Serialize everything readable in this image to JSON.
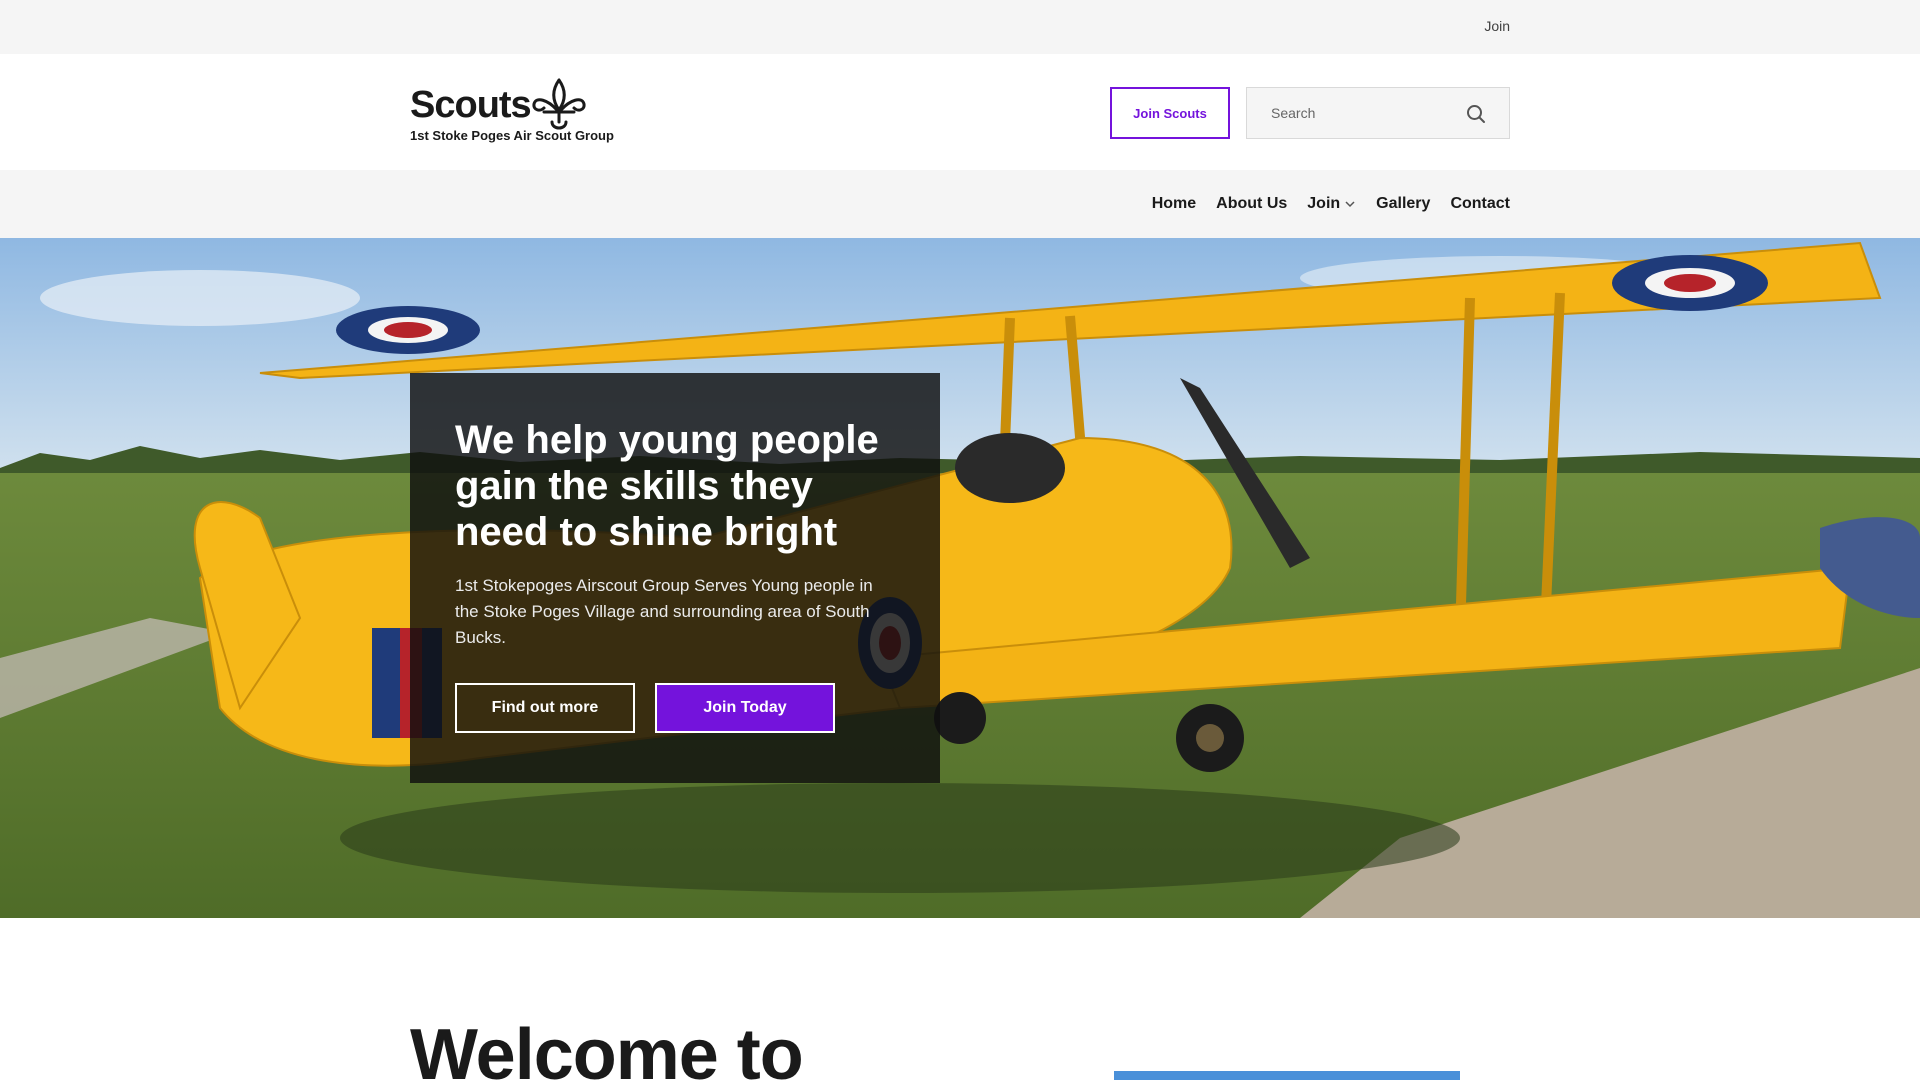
{
  "utility_bar": {
    "join_link": "Join"
  },
  "header": {
    "logo_word": "Scouts",
    "logo_subtitle": "1st Stoke Poges Air Scout Group",
    "join_button": "Join Scouts",
    "search_placeholder": "Search"
  },
  "nav": {
    "items": [
      {
        "label": "Home"
      },
      {
        "label": "About Us"
      },
      {
        "label": "Join"
      },
      {
        "label": "Gallery"
      },
      {
        "label": "Contact"
      }
    ]
  },
  "hero": {
    "title": "We help young people gain the skills they need to shine bright",
    "text": "1st Stokepoges Airscout Group Serves Young people in the Stoke Poges Village and surrounding area of South Bucks.",
    "find_out_more": "Find out more",
    "join_today": "Join Today"
  },
  "welcome": {
    "title": "Welcome to"
  },
  "colors": {
    "brand_purple": "#7413dc",
    "plane_yellow": "#f5b614",
    "grass": "#5f7f30",
    "sky": "#9fc3e6"
  }
}
